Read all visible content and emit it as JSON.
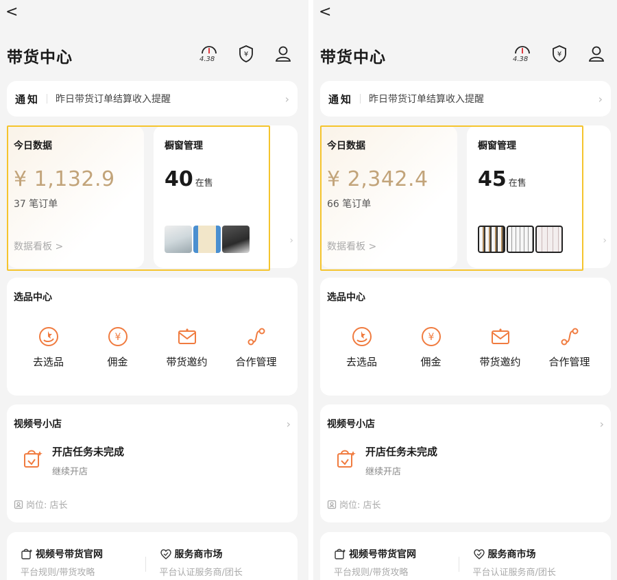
{
  "colors": {
    "accent": "#f07b3f",
    "gold": "#c2a47a",
    "highlight": "#f5c42c"
  },
  "panels": [
    {
      "back": "<",
      "title": "带货中心",
      "speed_value": "4.38",
      "notice": {
        "tag": "通知",
        "text": "昨日带货订单结算收入提醒"
      },
      "today": {
        "label": "今日数据",
        "amount": "¥ 1,132.9",
        "orders": "37 笔订单",
        "link": "数据看板 >"
      },
      "shop": {
        "label": "橱窗管理",
        "count": "40",
        "unit": "在售"
      },
      "select": {
        "title": "选品中心",
        "items": [
          "去选品",
          "佣金",
          "带货邀约",
          "合作管理"
        ]
      },
      "store": {
        "title": "视频号小店",
        "task_title": "开店任务未完成",
        "task_sub": "继续开店",
        "role": "岗位: 店长"
      },
      "bottom": [
        {
          "title": "视频号带货官网",
          "sub": "平台规则/带货攻略"
        },
        {
          "title": "服务商市场",
          "sub": "平台认证服务商/团长"
        }
      ]
    },
    {
      "back": "<",
      "title": "带货中心",
      "speed_value": "4.38",
      "notice": {
        "tag": "通知",
        "text": "昨日带货订单结算收入提醒"
      },
      "today": {
        "label": "今日数据",
        "amount": "¥ 2,342.4",
        "orders": "66 笔订单",
        "link": "数据看板 >"
      },
      "shop": {
        "label": "橱窗管理",
        "count": "45",
        "unit": "在售"
      },
      "select": {
        "title": "选品中心",
        "items": [
          "去选品",
          "佣金",
          "带货邀约",
          "合作管理"
        ]
      },
      "store": {
        "title": "视频号小店",
        "task_title": "开店任务未完成",
        "task_sub": "继续开店",
        "role": "岗位: 店长"
      },
      "bottom": [
        {
          "title": "视频号带货官网",
          "sub": "平台规则/带货攻略"
        },
        {
          "title": "服务商市场",
          "sub": "平台认证服务商/团长"
        }
      ]
    }
  ]
}
